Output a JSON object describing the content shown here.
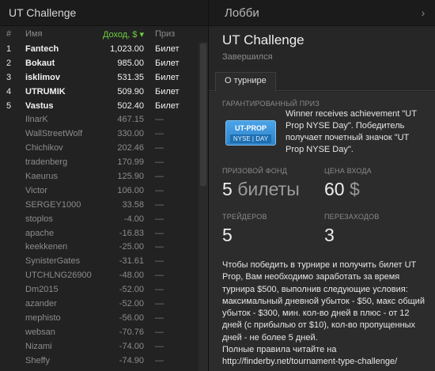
{
  "left_header": {
    "title": "UT Challenge"
  },
  "right_header": {
    "title": "Лобби",
    "chevron": "›"
  },
  "table": {
    "columns": {
      "num": "#",
      "name": "Имя",
      "income": "Доход, $ ▾",
      "prize": "Приз"
    },
    "rows": [
      {
        "num": "1",
        "name": "Fantech",
        "income": "1,023.00",
        "prize": "Билет",
        "winner": true
      },
      {
        "num": "2",
        "name": "Bokaut",
        "income": "985.00",
        "prize": "Билет",
        "winner": true
      },
      {
        "num": "3",
        "name": "isklimov",
        "income": "531.35",
        "prize": "Билет",
        "winner": true
      },
      {
        "num": "4",
        "name": "UTRUMIK",
        "income": "509.90",
        "prize": "Билет",
        "winner": true
      },
      {
        "num": "5",
        "name": "Vastus",
        "income": "502.40",
        "prize": "Билет",
        "winner": true
      },
      {
        "num": "",
        "name": "IlnarK",
        "income": "467.15",
        "prize": "—",
        "winner": false
      },
      {
        "num": "",
        "name": "WallStreetWolf",
        "income": "330.00",
        "prize": "—",
        "winner": false
      },
      {
        "num": "",
        "name": "Chichikov",
        "income": "202.46",
        "prize": "—",
        "winner": false
      },
      {
        "num": "",
        "name": "tradenberg",
        "income": "170.99",
        "prize": "—",
        "winner": false
      },
      {
        "num": "",
        "name": "Kaeurus",
        "income": "125.90",
        "prize": "—",
        "winner": false
      },
      {
        "num": "",
        "name": "Victor",
        "income": "106.00",
        "prize": "—",
        "winner": false
      },
      {
        "num": "",
        "name": "SERGEY1000",
        "income": "33.58",
        "prize": "—",
        "winner": false
      },
      {
        "num": "",
        "name": "stoplos",
        "income": "-4.00",
        "prize": "—",
        "winner": false
      },
      {
        "num": "",
        "name": "apache",
        "income": "-16.83",
        "prize": "—",
        "winner": false
      },
      {
        "num": "",
        "name": "keekkenen",
        "income": "-25.00",
        "prize": "—",
        "winner": false
      },
      {
        "num": "",
        "name": "SynisterGates",
        "income": "-31.61",
        "prize": "—",
        "winner": false
      },
      {
        "num": "",
        "name": "UTCHLNG26900",
        "income": "-48.00",
        "prize": "—",
        "winner": false
      },
      {
        "num": "",
        "name": "Dm2015",
        "income": "-52.00",
        "prize": "—",
        "winner": false
      },
      {
        "num": "",
        "name": "azander",
        "income": "-52.00",
        "prize": "—",
        "winner": false
      },
      {
        "num": "",
        "name": "mephisto",
        "income": "-56.00",
        "prize": "—",
        "winner": false
      },
      {
        "num": "",
        "name": "websan",
        "income": "-70.76",
        "prize": "—",
        "winner": false
      },
      {
        "num": "",
        "name": "Nizami",
        "income": "-74.00",
        "prize": "—",
        "winner": false
      },
      {
        "num": "",
        "name": "Sheffy",
        "income": "-74.90",
        "prize": "—",
        "winner": false
      }
    ]
  },
  "tournament": {
    "title": "UT Challenge",
    "status": "Завершился",
    "tab": "О турнире",
    "guaranteed_label": "ГАРАНТИРОВАННЫЙ ПРИЗ",
    "badge_top": "UT-PROP",
    "badge_bottom": "NYSE | DAY",
    "guaranteed_text": "Winner receives achievement \"UT Prop NYSE Day\". Победитель получает почетный значок \"UT Prop NYSE Day\".",
    "prize_fund_label": "ПРИЗОВОЙ ФОНД",
    "prize_fund_value": "5",
    "prize_fund_unit": "билеты",
    "entry_label": "ЦЕНА ВХОДА",
    "entry_value": "60",
    "entry_unit": "$",
    "traders_label": "ТРЕЙДЕРОВ",
    "traders_value": "5",
    "reentries_label": "ПЕРЕЗАХОДОВ",
    "reentries_value": "3",
    "description": "Чтобы победить в турнире и получить билет UT Prop, Вам необходимо заработать за время турнира $500, выполнив следующие условия: максимальный дневной убыток - $50, макс общий убыток - $300, мин. кол-во дней в плюс - от 12 дней (с прибылью от $10), кол-во пропущенных дней - не более 5 дней.",
    "rules_line": "Полные правила читайте на",
    "rules_link": "http://finderby.net/tournament-type-challenge/"
  }
}
